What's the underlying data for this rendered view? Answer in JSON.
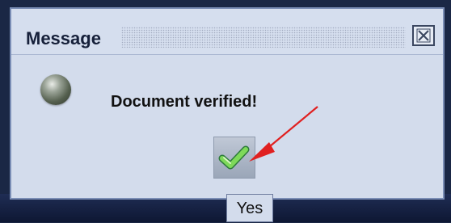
{
  "dialog": {
    "title": "Message",
    "message": "Document verified!",
    "status_icon": "green-status-light-icon",
    "close_icon": "close-icon",
    "confirm_button_icon": "checkmark-icon",
    "tooltip": "Yes"
  },
  "annotation": {
    "arrow_color": "#e02020"
  }
}
